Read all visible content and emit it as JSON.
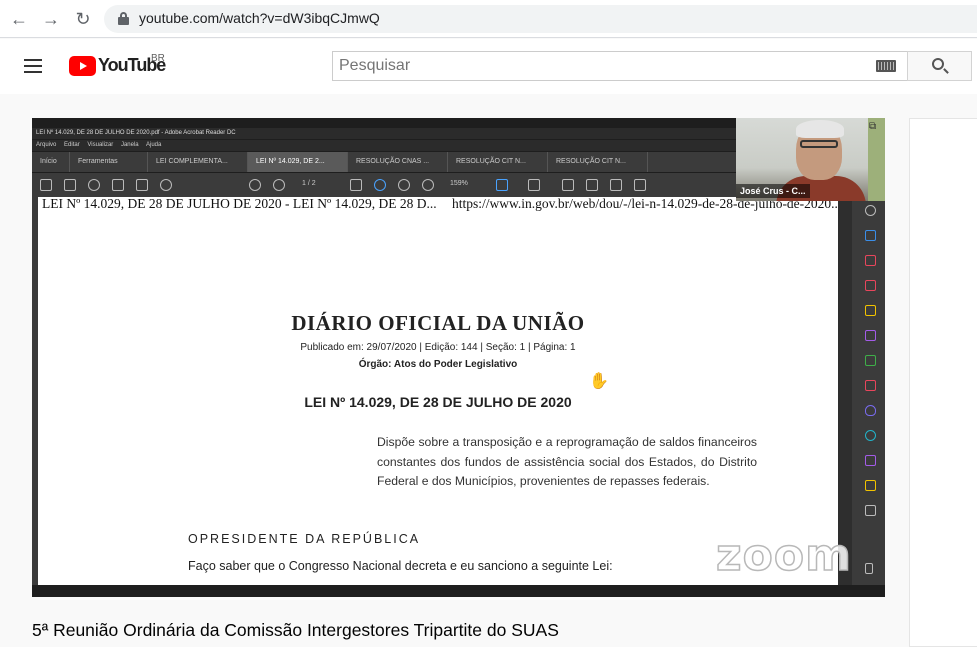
{
  "browser": {
    "url": "youtube.com/watch?v=dW3ibqCJmwQ",
    "back_icon": "←",
    "forward_icon": "→",
    "reload_icon": "↻"
  },
  "youtube": {
    "logo_text": "YouTube",
    "country_code": "BR",
    "search_placeholder": "Pesquisar"
  },
  "video": {
    "title": "5ª Reunião Ordinária da Comissão Intergestores Tripartite do SUAS",
    "participant_name": "José Crus - C...",
    "watermark": "zoom",
    "acrobat": {
      "window_title": "LEI Nº 14.029, DE 28 DE JULHO DE 2020.pdf - Adobe Acrobat Reader DC",
      "menu": [
        "Arquivo",
        "Editar",
        "Visualizar",
        "Janela",
        "Ajuda"
      ],
      "tabs": [
        "Início",
        "Ferramentas",
        "LEI COMPLEMENTA...",
        "LEI Nº 14.029, DE 2...",
        "RESOLUÇÃO CNAS ...",
        "RESOLUÇÃO CIT N...",
        "RESOLUÇÃO CIT N..."
      ],
      "active_tab_index": 3,
      "page_indicator": "1 / 2",
      "zoom_level": "159%"
    },
    "pdf": {
      "header_left": "LEI Nº 14.029, DE 28 DE JULHO DE 2020 - LEI Nº 14.029, DE 28 D...",
      "header_right": "https://www.in.gov.br/web/dou/-/lei-n-14.029-de-28-de-julho-de-2020...",
      "title": "DIÁRIO OFICIAL DA UNIÃO",
      "publication": "Publicado em: 29/07/2020 | Edição: 144 | Seção: 1 | Página: 1",
      "organ": "Órgão: Atos do Poder Legislativo",
      "law": "LEI Nº 14.029, DE 28 DE JULHO DE 2020",
      "summary": "Dispõe sobre a transposição e a reprogramação de saldos financeiros constantes dos fundos de assistência social dos Estados, do Distrito Federal e dos Municípios, provenientes de repasses federais.",
      "president": "OPRESIDENTE DA REPÚBLICA",
      "decree": "Faço saber que o Congresso Nacional decreta e eu sanciono a seguinte Lei:"
    }
  },
  "colors": {
    "youtube_red": "#ff0000",
    "acrobat_dark": "#3b3b3b"
  }
}
